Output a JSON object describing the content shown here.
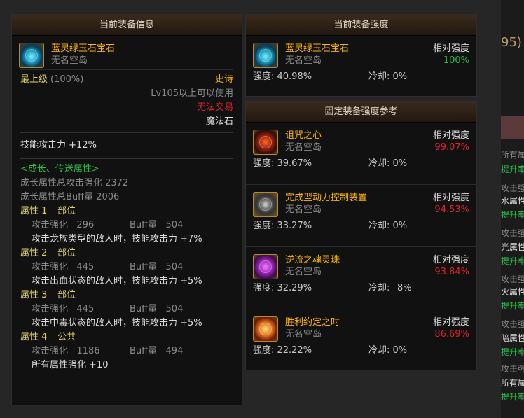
{
  "current_info": {
    "header": "当前装备信息",
    "item_name": "蓝灵绿玉石宝石",
    "item_sub": "无名空岛",
    "grade": "最上级",
    "grade_pct": "(100%)",
    "rarity": "史诗",
    "level_req": "Lv105以上可以使用",
    "trade": "无法交易",
    "type": "魔法石",
    "skill_atk": "技能攻击力  +12%",
    "growth_title": "<成长、传送属性>",
    "growth_atk": "成长属性总攻击强化 2372",
    "growth_buff": "成长属性总Buff量 2006",
    "attributes": [
      {
        "title": "属性 1 – 部位",
        "atk_label": "攻击强化",
        "atk": "296",
        "buff_label": "Buff量",
        "buff": "504",
        "desc": "攻击龙族类型的敌人时，技能攻击力 +7%"
      },
      {
        "title": "属性 2 – 部位",
        "atk_label": "攻击强化",
        "atk": "445",
        "buff_label": "Buff量",
        "buff": "504",
        "desc": "攻击出血状态的敌人时，技能攻击力 +5%"
      },
      {
        "title": "属性 3 – 部位",
        "atk_label": "攻击强化",
        "atk": "445",
        "buff_label": "Buff量",
        "buff": "504",
        "desc": "攻击中毒状态的敌人时，技能攻击力 +5%"
      },
      {
        "title": "属性 4 – 公共",
        "atk_label": "攻击强化",
        "atk": "1186",
        "buff_label": "Buff量",
        "buff": "494",
        "desc": "所有属性强化 +10"
      }
    ]
  },
  "current_strength": {
    "header": "当前装备强度",
    "item_name": "蓝灵绿玉石宝石",
    "item_sub": "无名空岛",
    "rel_label": "相对强度",
    "rel_value": "100%",
    "strength": "强度: 40.98%",
    "cooldown": "冷却: 0%"
  },
  "reference": {
    "header": "固定装备强度参考",
    "items": [
      {
        "name": "诅咒之心",
        "sub": "无名空岛",
        "rel_label": "相对强度",
        "rel_value": "99.07%",
        "strength": "强度: 39.67%",
        "cooldown": "冷却: 0%",
        "icon": "curse-heart-icon"
      },
      {
        "name": "完成型动力控制装置",
        "sub": "无名空岛",
        "rel_label": "相对强度",
        "rel_value": "94.53%",
        "strength": "强度: 33.27%",
        "cooldown": "冷却: 0%",
        "icon": "power-control-icon"
      },
      {
        "name": "逆流之魂灵珠",
        "sub": "无名空岛",
        "rel_label": "相对强度",
        "rel_value": "93.84%",
        "strength": "强度: 32.29%",
        "cooldown": "冷却: –8%",
        "icon": "soul-orb-icon"
      },
      {
        "name": "胜利约定之时",
        "sub": "无名空岛",
        "rel_label": "相对强度",
        "rel_value": "86.69%",
        "strength": "强度: 22.22%",
        "cooldown": "冷却: 0%",
        "icon": "victory-promise-icon"
      }
    ]
  },
  "background": {
    "snippet": "95)",
    "lines": [
      "所有属",
      "提升率",
      "攻击强",
      "水属性",
      "提升率",
      "攻击强",
      "光属性",
      "提升率",
      "攻击强",
      "火属性",
      "提升率",
      "攻击强",
      "暗属性",
      "提升率",
      "攻击强",
      "所有属",
      "提升率"
    ]
  },
  "colors": {
    "epic": "#ffb400",
    "green": "#2bbd4a",
    "red": "#e2222a",
    "highlight": "#e2d26a"
  }
}
